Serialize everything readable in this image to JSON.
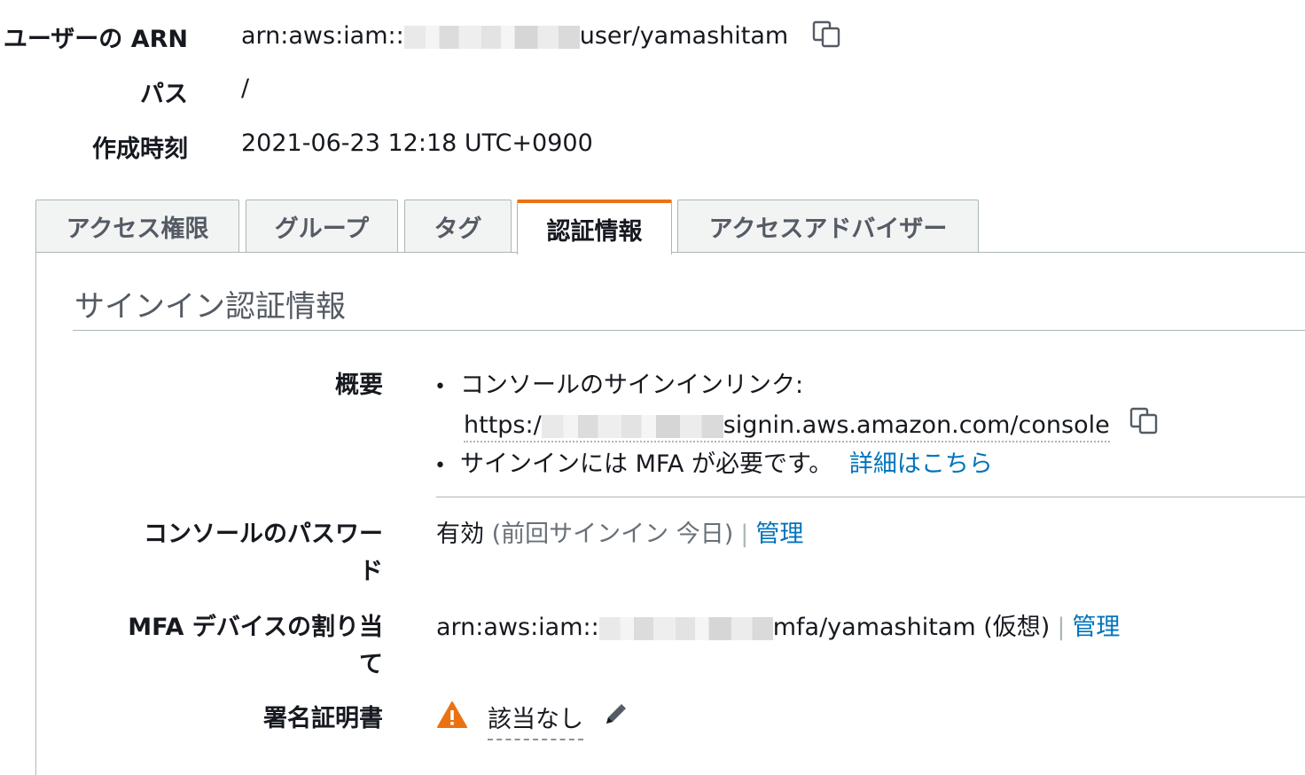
{
  "summary": {
    "arn_label": "ユーザーの ARN",
    "arn_prefix": "arn:aws:iam::",
    "arn_suffix": "user/yamashitam",
    "path_label": "パス",
    "path_value": "/",
    "created_label": "作成時刻",
    "created_value": "2021-06-23 12:18 UTC+0900"
  },
  "tabs": [
    {
      "label": "アクセス権限",
      "active": false
    },
    {
      "label": "グループ",
      "active": false
    },
    {
      "label": "タグ",
      "active": false
    },
    {
      "label": "認証情報",
      "active": true
    },
    {
      "label": "アクセスアドバイザー",
      "active": false
    }
  ],
  "signin": {
    "title": "サインイン認証情報",
    "overview_label": "概要",
    "console_link_label": "コンソールのサインインリンク:",
    "console_link_prefix": "https:/",
    "console_link_suffix": "signin.aws.amazon.com/console",
    "mfa_required_text": "サインインには MFA が必要です。",
    "mfa_details_link": "詳細はこちら",
    "password_label_line1": "コンソールのパスワー",
    "password_label_line2": "ド",
    "password_status": "有効",
    "password_last": "(前回サインイン 今日)",
    "password_separator": "|",
    "password_manage": "管理",
    "mfa_label_line1": "MFA デバイスの割り当",
    "mfa_label_line2": "て",
    "mfa_prefix": "arn:aws:iam::",
    "mfa_suffix": "mfa/yamashitam (仮想)",
    "mfa_separator": "|",
    "mfa_manage": "管理",
    "cert_label": "署名証明書",
    "cert_value": "該当なし"
  },
  "colors": {
    "accent_tab": "#ec7211",
    "link": "#0073bb",
    "warning": "#ec7211"
  }
}
